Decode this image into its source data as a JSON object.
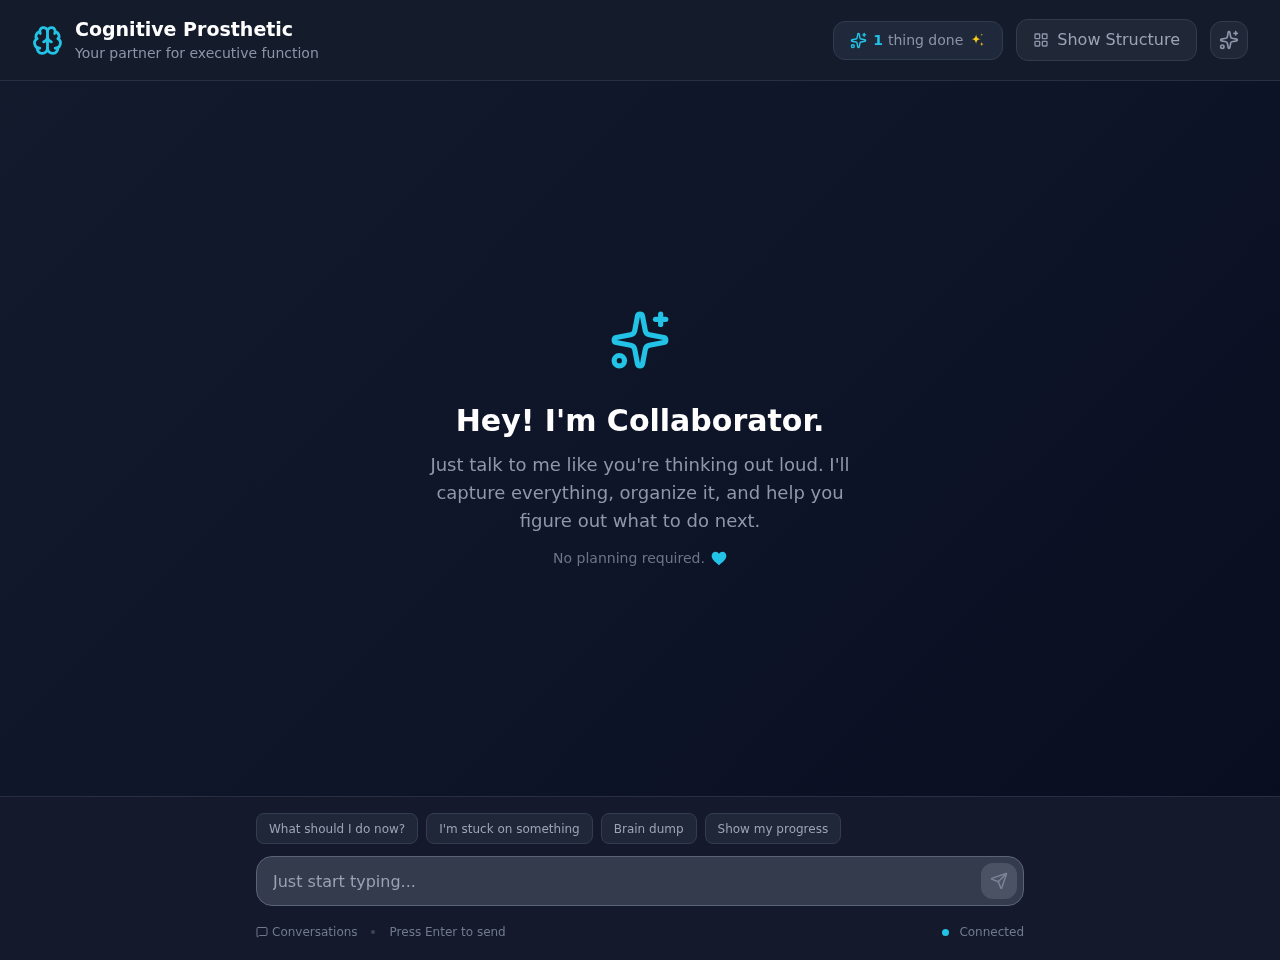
{
  "header": {
    "title": "Cognitive Prosthetic",
    "subtitle": "Your partner for executive function",
    "done_badge": {
      "count": "1",
      "label": "thing done"
    },
    "structure_button": {
      "label": "Show Structure"
    }
  },
  "welcome": {
    "heading": "Hey! I'm Collaborator.",
    "body": "Just talk to me like you're thinking out loud. I'll capture everything, organize it, and help you figure out what to do next.",
    "note": "No planning required."
  },
  "composer": {
    "suggestions": [
      "What should I do now?",
      "I'm stuck on something",
      "Brain dump",
      "Show my progress"
    ],
    "input": {
      "placeholder": "Just start typing..."
    },
    "send_button": {
      "disabled": true
    }
  },
  "footer": {
    "conversations_link": "Conversations",
    "hint": "Press Enter to send",
    "status": {
      "label": "Connected",
      "connected": true
    }
  }
}
